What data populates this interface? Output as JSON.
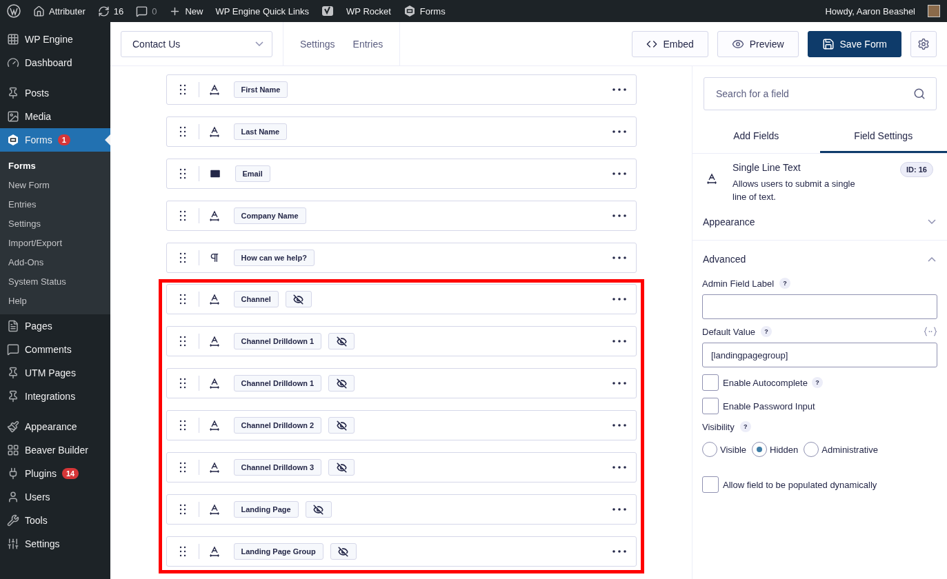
{
  "admin_bar": {
    "items": [
      {
        "kind": "home",
        "label": "Attributer"
      },
      {
        "kind": "updates",
        "label": "16"
      },
      {
        "kind": "comments",
        "label": "0",
        "disabled": true
      },
      {
        "kind": "new",
        "label": "New"
      },
      {
        "kind": "link",
        "label": "WP Engine Quick Links"
      },
      {
        "kind": "yoast"
      },
      {
        "kind": "link",
        "label": "WP Rocket"
      },
      {
        "kind": "forms",
        "label": "Forms"
      }
    ],
    "greeting": "Howdy, Aaron Beashel"
  },
  "sidebar": {
    "groups": [
      [
        {
          "label": "WP Engine",
          "selected": false
        },
        {
          "label": "Dashboard",
          "selected": false
        }
      ],
      [
        {
          "label": "Posts",
          "selected": false
        },
        {
          "label": "Media",
          "selected": false
        },
        {
          "label": "Forms",
          "selected": true,
          "badge": "1",
          "children": [
            {
              "label": "Forms",
              "selected": true
            },
            {
              "label": "New Form",
              "selected": false
            },
            {
              "label": "Entries",
              "selected": false
            },
            {
              "label": "Settings",
              "selected": false
            },
            {
              "label": "Import/Export",
              "selected": false
            },
            {
              "label": "Add-Ons",
              "selected": false
            },
            {
              "label": "System Status",
              "selected": false
            },
            {
              "label": "Help",
              "selected": false
            }
          ]
        },
        {
          "label": "Pages",
          "selected": false
        },
        {
          "label": "Comments",
          "selected": false
        },
        {
          "label": "UTM Pages",
          "selected": false
        },
        {
          "label": "Integrations",
          "selected": false
        }
      ],
      [
        {
          "label": "Appearance",
          "selected": false
        },
        {
          "label": "Beaver Builder",
          "selected": false
        },
        {
          "label": "Plugins",
          "selected": false,
          "badge": "14"
        },
        {
          "label": "Users",
          "selected": false
        },
        {
          "label": "Tools",
          "selected": false
        },
        {
          "label": "Settings",
          "selected": false
        }
      ]
    ]
  },
  "header": {
    "form_select": "Contact Us",
    "links": [
      "Settings",
      "Entries"
    ],
    "buttons": [
      {
        "kind": "embed",
        "label": "Embed"
      },
      {
        "kind": "preview",
        "label": "Preview"
      },
      {
        "kind": "save",
        "label": "Save Form"
      },
      {
        "kind": "settings"
      }
    ]
  },
  "field_groups": [
    {
      "highlighted": false,
      "fields": [
        {
          "kind": "text",
          "label": "First Name",
          "hidden": false
        },
        {
          "kind": "text",
          "label": "Last Name",
          "hidden": false
        },
        {
          "kind": "email",
          "label": "Email",
          "hidden": false
        },
        {
          "kind": "text",
          "label": "Company Name",
          "hidden": false
        },
        {
          "kind": "paragraph",
          "label": "How can we help?",
          "hidden": false
        }
      ]
    },
    {
      "highlighted": true,
      "fields": [
        {
          "kind": "text",
          "label": "Channel",
          "hidden": true
        },
        {
          "kind": "text",
          "label": "Channel Drilldown 1",
          "hidden": true
        },
        {
          "kind": "text",
          "label": "Channel Drilldown 1",
          "hidden": true
        },
        {
          "kind": "text",
          "label": "Channel Drilldown 2",
          "hidden": true
        },
        {
          "kind": "text",
          "label": "Channel Drilldown 3",
          "hidden": true
        },
        {
          "kind": "text",
          "label": "Landing Page",
          "hidden": true
        },
        {
          "kind": "text",
          "label": "Landing Page Group",
          "hidden": true
        }
      ]
    }
  ],
  "panel": {
    "search": {
      "placeholder": "Search for a field"
    },
    "tabs": [
      {
        "label": "Add Fields",
        "selected": false
      },
      {
        "label": "Field Settings",
        "selected": true
      }
    ],
    "field_info": {
      "title": "Single Line Text",
      "description": "Allows users to submit a single line of text.",
      "id": "ID: 16"
    },
    "sections": [
      {
        "title": "Appearance",
        "expanded": false
      },
      {
        "title": "Advanced",
        "expanded": true
      }
    ],
    "settings": [
      {
        "kind": "input",
        "label": "Admin Field Label",
        "help": "?"
      },
      {
        "kind": "input",
        "label": "Default Value",
        "help": "?",
        "merge_tags": true,
        "value": "[landingpagegroup]"
      },
      {
        "kind": "checkbox",
        "label": "Enable Autocomplete",
        "help": "?",
        "checked": false
      },
      {
        "kind": "checkbox",
        "label": "Enable Password Input",
        "checked": false
      },
      {
        "kind": "radio",
        "label": "Visibility",
        "help": "?",
        "options": [
          {
            "label": "Visible",
            "selected": false
          },
          {
            "label": "Hidden",
            "selected": true
          },
          {
            "label": "Administrative",
            "selected": false
          }
        ]
      },
      {
        "kind": "checkbox",
        "label": "Allow field to be populated dynamically",
        "checked": false
      }
    ]
  }
}
